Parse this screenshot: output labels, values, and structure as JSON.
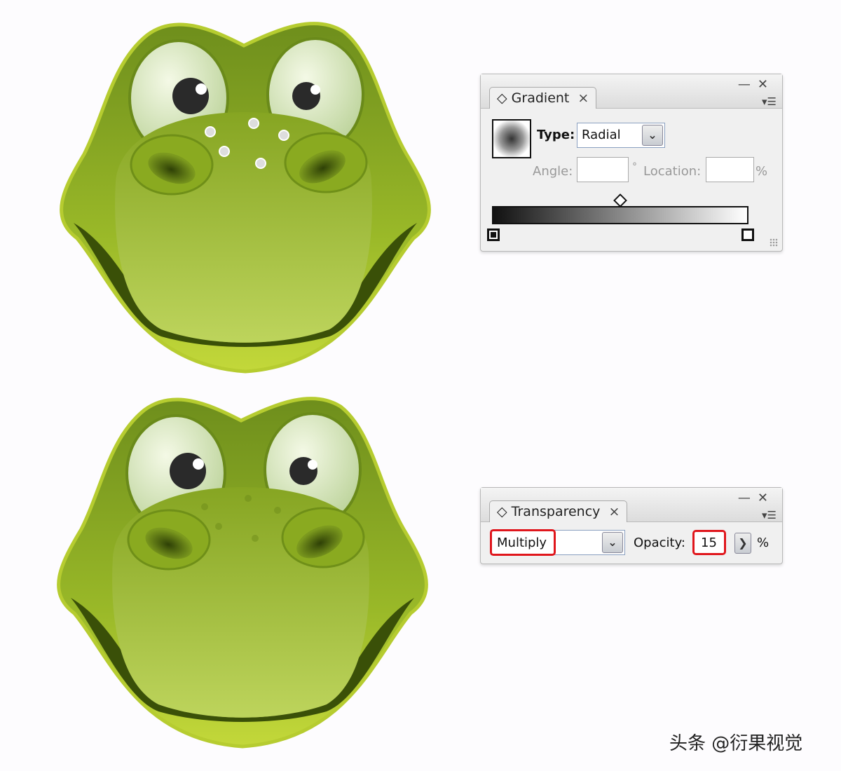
{
  "gradient_panel": {
    "tab_label": "Gradient",
    "type_label": "Type:",
    "type_value": "Radial",
    "angle_label": "Angle:",
    "angle_value": "",
    "degree_symbol": "°",
    "location_label": "Location:",
    "location_value": "",
    "percent_symbol": "%",
    "gradient_stops": [
      "#000000",
      "#ffffff"
    ]
  },
  "transparency_panel": {
    "tab_label": "Transparency",
    "blend_mode": "Multiply",
    "opacity_label": "Opacity:",
    "opacity_value": "15",
    "percent_symbol": "%",
    "highlight_color": "#e0161c"
  },
  "icons": {
    "tab_icon": "◇",
    "close": "×",
    "minimize": "—",
    "panel_close": "✕",
    "menu": "▾☰",
    "dropdown": "⌄",
    "arrow_right": "❯"
  },
  "watermark": "头条 @衍果视觉",
  "colors": {
    "frog_green": "#8fb025",
    "frog_light": "#b9d04a",
    "frog_dark": "#4a6a10"
  }
}
